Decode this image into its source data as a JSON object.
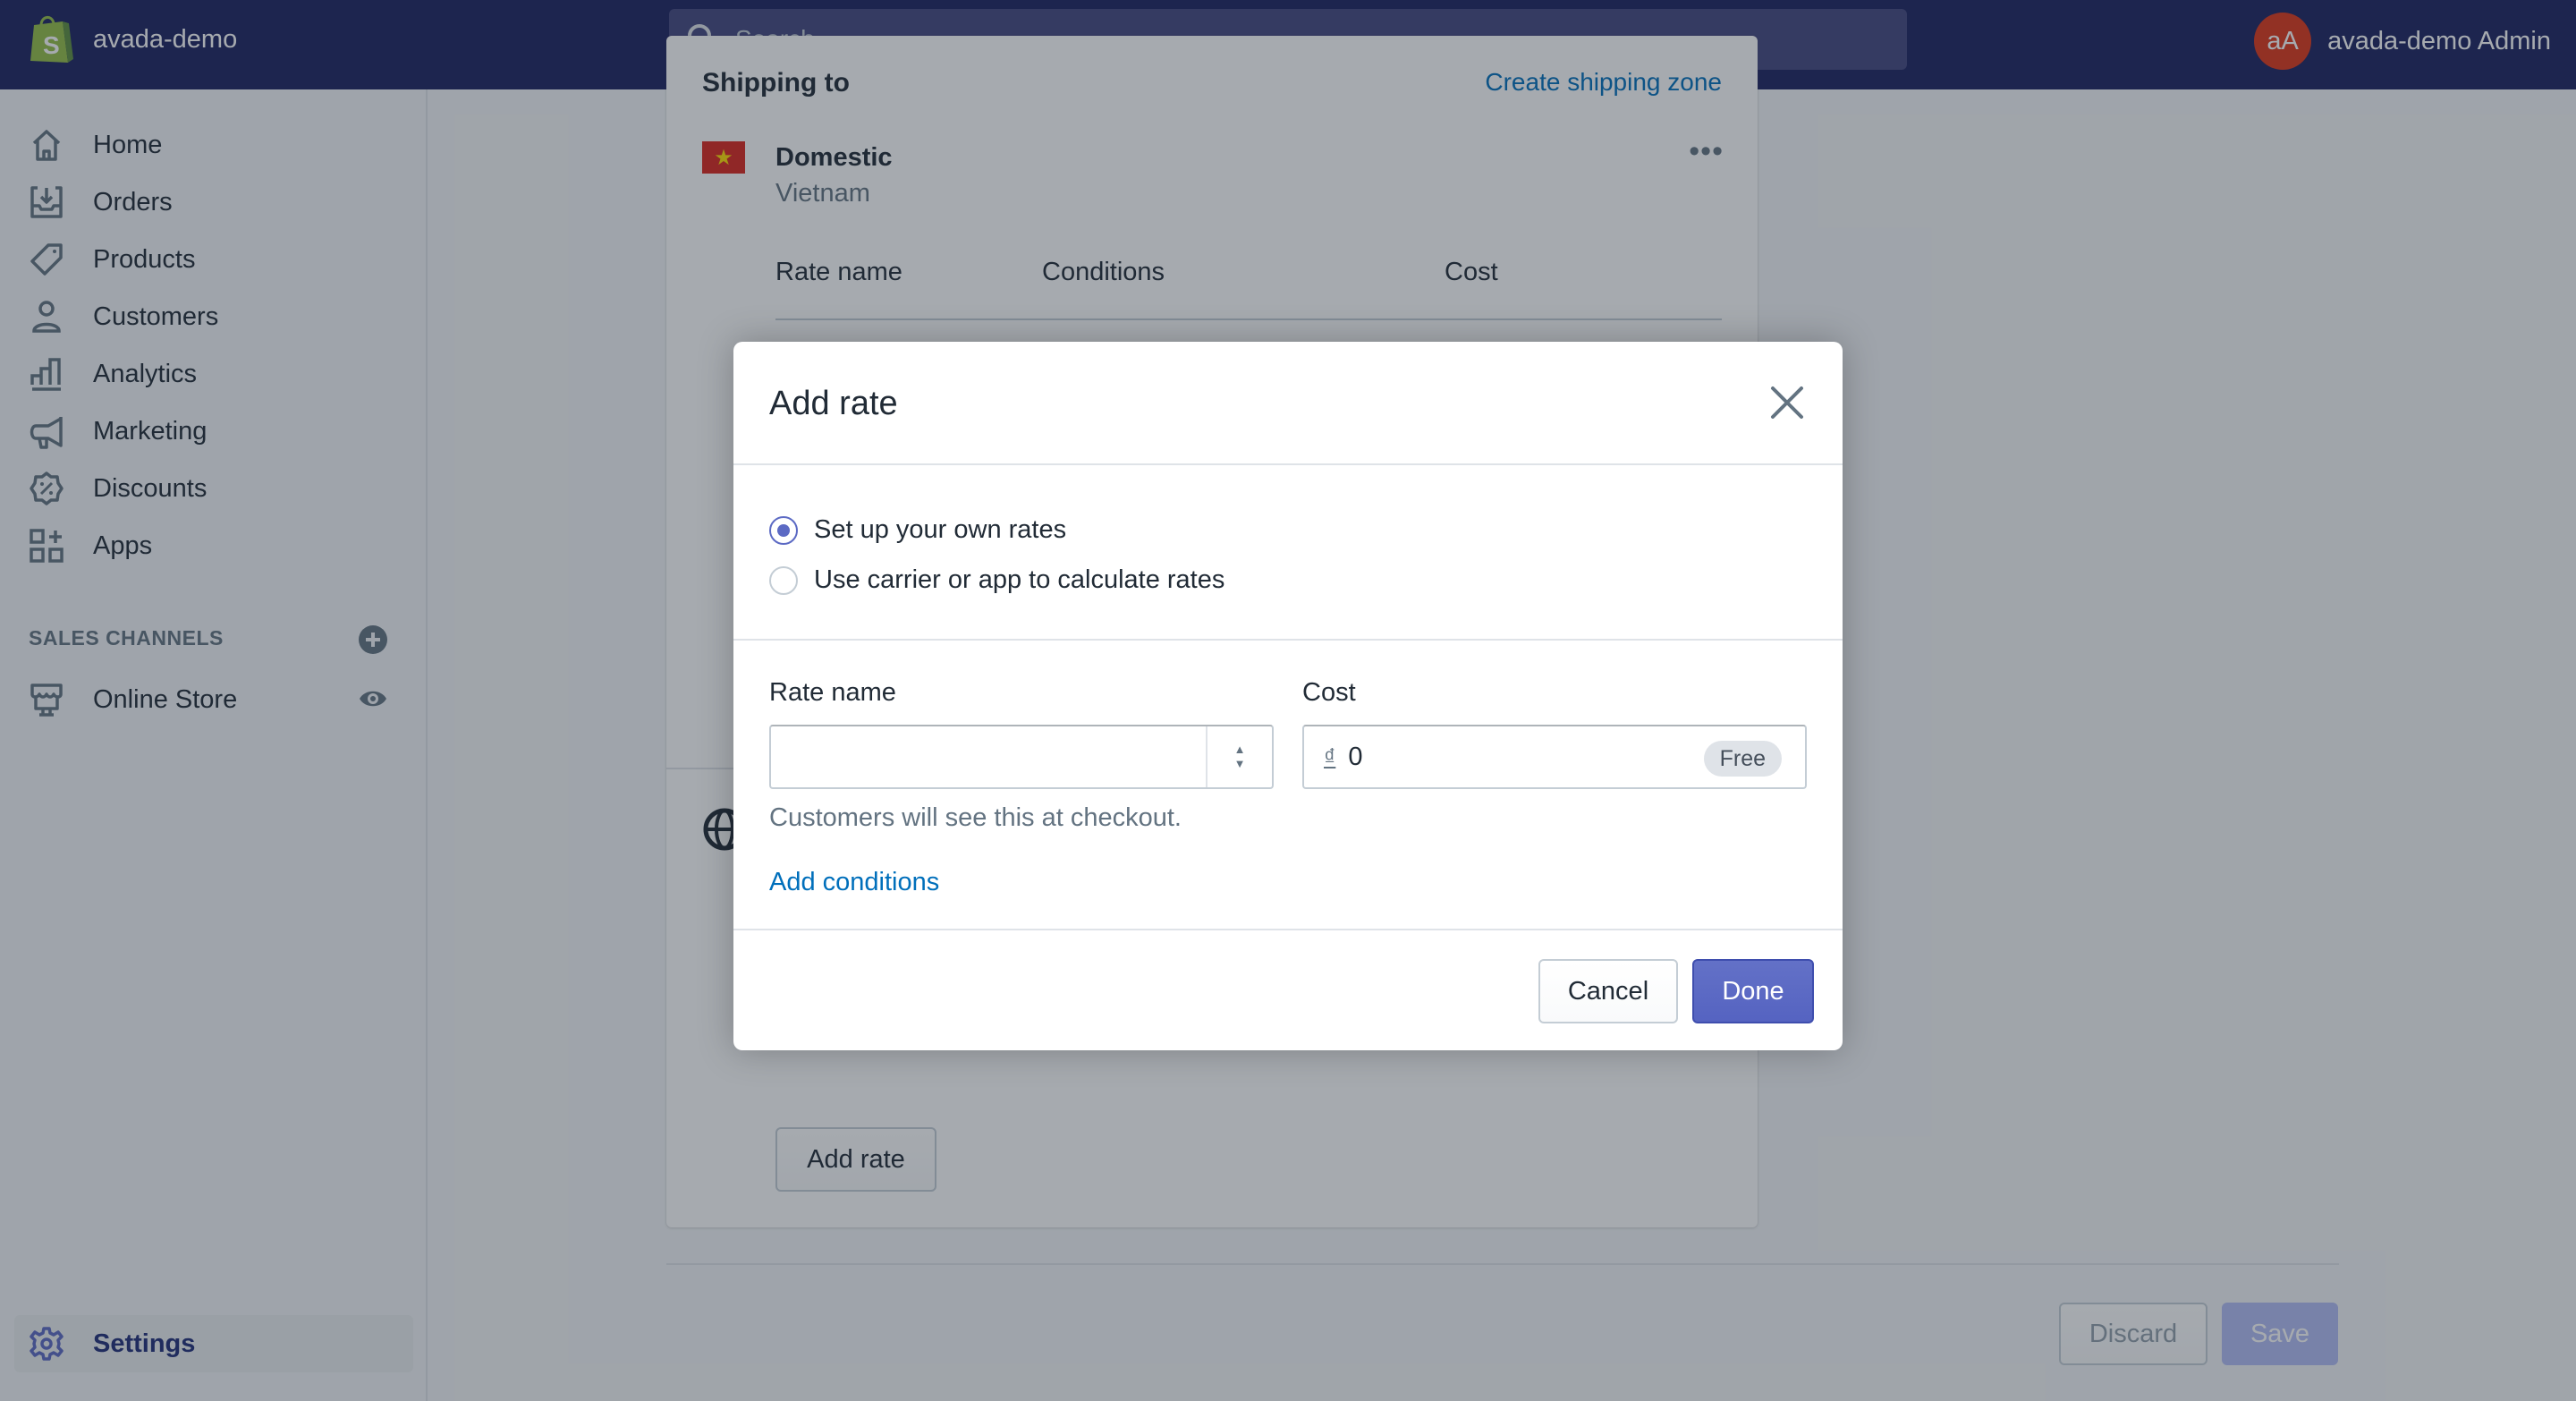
{
  "topbar": {
    "shop_name": "avada-demo",
    "search_placeholder": "Search",
    "avatar_initials": "aA",
    "user_name": "avada-demo Admin"
  },
  "sidebar": {
    "items": [
      {
        "label": "Home",
        "icon": "home-icon"
      },
      {
        "label": "Orders",
        "icon": "orders-icon"
      },
      {
        "label": "Products",
        "icon": "tag-icon"
      },
      {
        "label": "Customers",
        "icon": "person-icon"
      },
      {
        "label": "Analytics",
        "icon": "bar-chart-icon"
      },
      {
        "label": "Marketing",
        "icon": "megaphone-icon"
      },
      {
        "label": "Discounts",
        "icon": "discount-icon"
      },
      {
        "label": "Apps",
        "icon": "apps-icon"
      }
    ],
    "sales_channels_title": "SALES CHANNELS",
    "online_store": "Online Store",
    "settings": "Settings"
  },
  "content": {
    "shipping_title": "Shipping to",
    "create_zone": "Create shipping zone",
    "zone_name": "Domestic",
    "zone_country": "Vietnam",
    "more": "•••",
    "columns": [
      "Rate name",
      "Conditions",
      "Cost"
    ],
    "add_rate_button": "Add rate",
    "discard": "Discard",
    "save": "Save"
  },
  "modal": {
    "title": "Add rate",
    "radio_options": [
      {
        "label": "Set up your own rates",
        "checked": true
      },
      {
        "label": "Use carrier or app to calculate rates",
        "checked": false
      }
    ],
    "rate_name_label": "Rate name",
    "rate_name_value": "",
    "cost_label": "Cost",
    "currency_symbol": "₫",
    "cost_value": "0",
    "free_badge": "Free",
    "help_text": "Customers will see this at checkout.",
    "add_conditions": "Add conditions",
    "cancel": "Cancel",
    "done": "Done"
  }
}
